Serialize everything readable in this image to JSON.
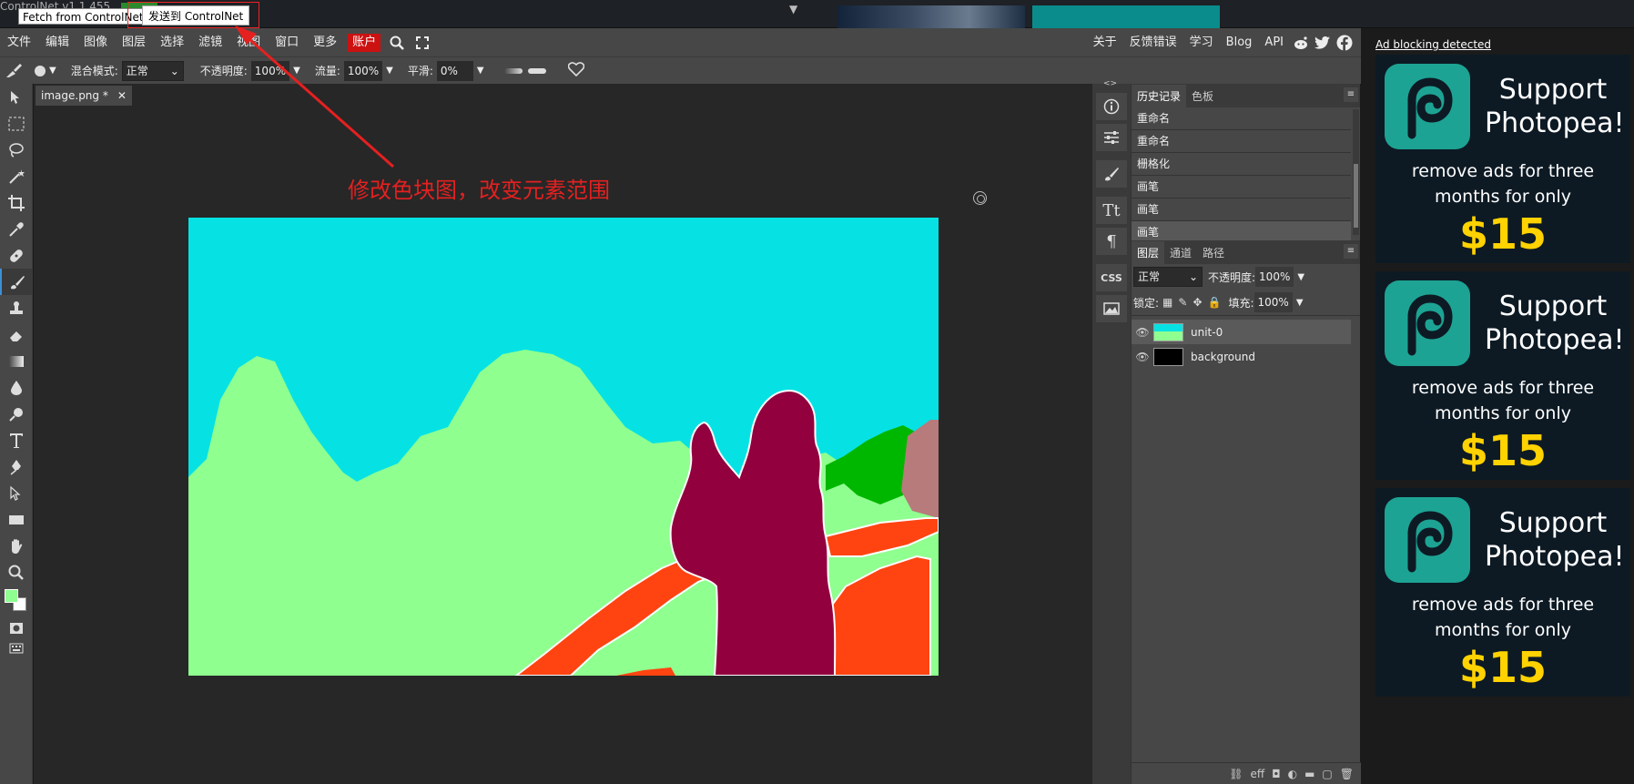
{
  "topbar": {
    "controlnet_title": "ControlNet v1.1.455",
    "fetch_button": "Fetch from ControlNet",
    "send_button": "发送到 ControlNet",
    "collapse_icon": "▼"
  },
  "menubar": {
    "items": [
      "文件",
      "编辑",
      "图像",
      "图层",
      "选择",
      "滤镜",
      "视图",
      "窗口",
      "更多"
    ],
    "account": "账户",
    "right_items": [
      "关于",
      "反馈错误",
      "学习",
      "Blog",
      "API"
    ]
  },
  "options": {
    "blend_mode_label": "混合模式:",
    "blend_mode_value": "正常",
    "opacity_label": "不透明度:",
    "opacity_value": "100%",
    "flow_label": "流量:",
    "flow_value": "100%",
    "smoothing_label": "平滑:",
    "smoothing_value": "0%",
    "brush_size": "15"
  },
  "document": {
    "tab_name": "image.png *",
    "annotation": "修改色块图，改变元素范围"
  },
  "history_panel": {
    "tabs": [
      "历史记录",
      "色板"
    ],
    "items": [
      "重命名",
      "重命名",
      "栅格化",
      "画笔",
      "画笔",
      "画笔"
    ]
  },
  "layers_panel": {
    "tabs": [
      "图层",
      "通道",
      "路径"
    ],
    "blend_mode": "正常",
    "opacity_label": "不透明度:",
    "opacity_value": "100%",
    "lock_label": "锁定:",
    "fill_label": "填充:",
    "fill_value": "100%",
    "layers": [
      "unit-0",
      "background"
    ],
    "footer": [
      "⛓",
      "eff",
      "◘",
      "◐",
      "▬",
      "▢",
      "🗑"
    ]
  },
  "ads": {
    "link": "Ad blocking detected",
    "title": "Support Photopea!",
    "text": "remove ads for three months for only",
    "price": "$15",
    "count": 3
  },
  "colors": {
    "foreground": "#8fff8f",
    "background": "#ffffff",
    "sky": "#06e2e4",
    "hills": "#8fff8f",
    "person": "#92003e",
    "accent_red": "#ff4411",
    "tree": "#00b700",
    "rock": "#b77b7b",
    "ad_teal": "#1da393",
    "ad_price": "#ffd200"
  },
  "icons": {
    "tools": [
      "move-icon",
      "marquee-icon",
      "lasso-icon",
      "magic-wand-icon",
      "crop-icon",
      "eyedropper-icon",
      "healing-icon",
      "brush-icon",
      "stamp-icon",
      "eraser-icon",
      "gradient-icon",
      "blur-icon",
      "dodge-icon",
      "text-icon",
      "pen-icon",
      "path-select-icon",
      "shape-icon",
      "hand-icon",
      "zoom-icon"
    ]
  }
}
